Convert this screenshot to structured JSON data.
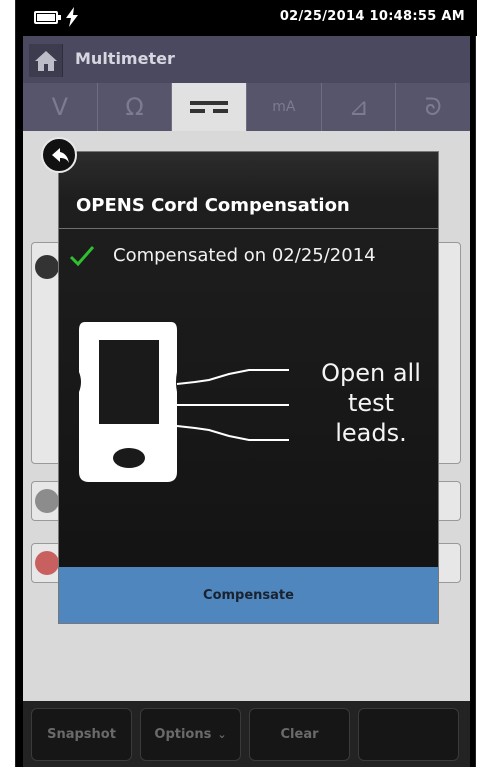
{
  "status_bar": {
    "datetime": "02/25/2014 10:48:55 AM",
    "battery_icon": "battery-icon",
    "charging_icon": "lightning-icon"
  },
  "app": {
    "title": "Multimeter",
    "home_icon": "home-icon"
  },
  "tabs": [
    {
      "name": "voltage-ac-dc",
      "symbol": "V"
    },
    {
      "name": "resistance",
      "symbol": "Ω"
    },
    {
      "name": "dc",
      "symbol": "⎓"
    },
    {
      "name": "milliamps",
      "symbol": "mA"
    },
    {
      "name": "diode",
      "symbol": "⊿"
    },
    {
      "name": "coil",
      "symbol": "ᘐ"
    }
  ],
  "dialog": {
    "title": "OPENS Cord Compensation",
    "status": "Compensated on 02/25/2014",
    "instruction": "Open all test leads.",
    "button": "Compensate"
  },
  "bottom_bar": {
    "snapshot": "Snapshot",
    "options": "Options",
    "options_caret": "⌄",
    "clear": "Clear",
    "empty": ""
  },
  "colors": {
    "accent_button": "#4f86be",
    "titlebar": "#4a4960",
    "check": "#2fbf2f"
  }
}
